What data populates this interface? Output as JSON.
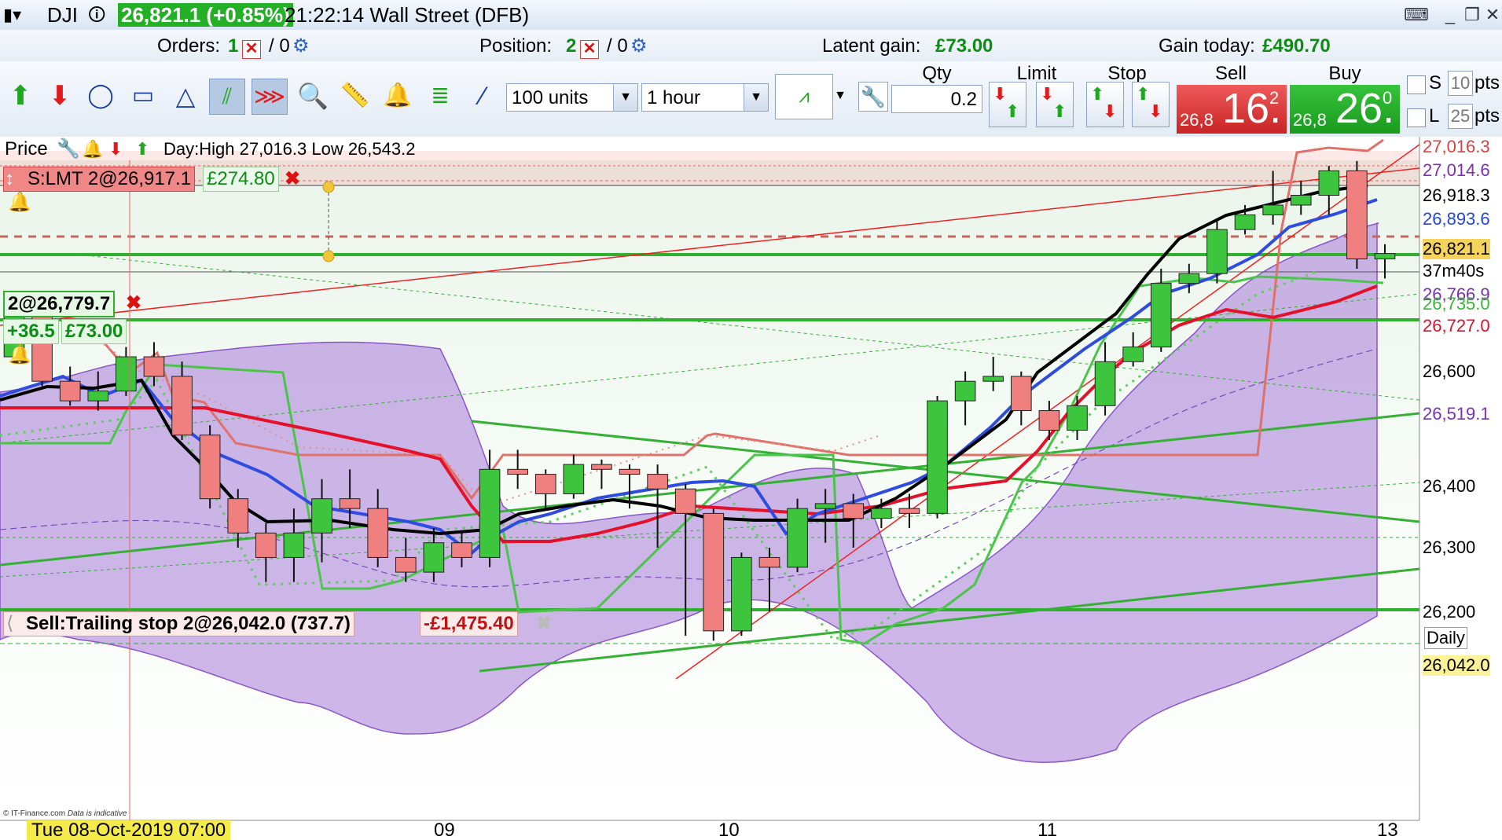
{
  "title_bar": {
    "symbol": "DJI",
    "price_change": "26,821.1 (+0.85%)",
    "clock_market": "21:22:14 Wall Street (DFB)"
  },
  "info_bar": {
    "orders_label": "Orders:",
    "orders_count": "1",
    "orders_zero": "/ 0",
    "position_label": "Position:",
    "position_count": "2",
    "position_zero": "/ 0",
    "latent_gain_label": "Latent gain:",
    "latent_gain_value": "£73.00",
    "gain_today_label": "Gain today:",
    "gain_today_value": "£490.70"
  },
  "toolbar": {
    "units_select": "100 units",
    "interval_select": "1 hour",
    "qty_header": "Qty",
    "qty_value": "0.2",
    "limit_header": "Limit",
    "stop_header": "Stop",
    "sell_header": "Sell",
    "buy_header": "Buy",
    "sell_prefix": "26,8",
    "sell_big": "16.",
    "sell_sup": "2",
    "buy_prefix": "26,8",
    "buy_big": "26.",
    "buy_sup": "0",
    "s_label": "S",
    "s_value": "10",
    "s_unit": "pts",
    "l_label": "L",
    "l_value": "25",
    "l_unit": "pts"
  },
  "chart_header": {
    "price_label": "Price",
    "day_range": "Day:High 27,016.3 Low 26,543.2"
  },
  "orders": {
    "limit_order": "S:LMT 2@26,917.1",
    "limit_gain": "£274.80",
    "position": "2@26,779.7",
    "position_pts": "+36.5",
    "position_gain": "£73.00",
    "trailing_stop": "Sell:Trailing stop 2@26,042.0 (737.7)",
    "trailing_loss": "-£1,475.40"
  },
  "price_axis": {
    "labels": [
      {
        "text": "27,016.3",
        "color": "#d94141"
      },
      {
        "text": "27,014.6",
        "color": "#7a2fb5"
      },
      {
        "text": "26,918.3",
        "color": "#000000"
      },
      {
        "text": "26,893.6",
        "color": "#2347d6"
      },
      {
        "text": "26,821.1",
        "color": "#000000"
      },
      {
        "text": "37m40s",
        "color": "#000000"
      },
      {
        "text": "26,766.9",
        "color": "#7a2fb5"
      },
      {
        "text": "26,735.0",
        "color": "#3ab53a"
      },
      {
        "text": "26,727.0",
        "color": "#d8132b"
      },
      {
        "text": "26,600",
        "color": "#000000"
      },
      {
        "text": "26,519.1",
        "color": "#7a2fb5"
      },
      {
        "text": "26,400",
        "color": "#000000"
      },
      {
        "text": "26,300",
        "color": "#000000"
      },
      {
        "text": "26,200",
        "color": "#000000"
      },
      {
        "text": "Daily",
        "color": "#000000"
      },
      {
        "text": "26,042.0",
        "color": "#000000"
      }
    ]
  },
  "time_axis": {
    "cursor_label": "Tue 08-Oct-2019 07:00",
    "labels": [
      "09",
      "10",
      "11",
      "13"
    ]
  },
  "footer": {
    "credit": "© IT-Finance.com",
    "note": "Data is indicative"
  },
  "chart_data": {
    "type": "candlestick",
    "ylim": [
      26000,
      27050
    ],
    "x_ticks": [
      "09",
      "10",
      "11",
      "13"
    ],
    "candles": [
      {
        "o": 26610,
        "c": 26700,
        "h": 26705,
        "l": 26600
      },
      {
        "o": 26700,
        "c": 26560,
        "h": 26705,
        "l": 26550
      },
      {
        "o": 26560,
        "c": 26520,
        "h": 26590,
        "l": 26510
      },
      {
        "o": 26520,
        "c": 26540,
        "h": 26580,
        "l": 26500
      },
      {
        "o": 26540,
        "c": 26610,
        "h": 26630,
        "l": 26530
      },
      {
        "o": 26610,
        "c": 26570,
        "h": 26640,
        "l": 26550
      },
      {
        "o": 26570,
        "c": 26450,
        "h": 26600,
        "l": 26440
      },
      {
        "o": 26450,
        "c": 26320,
        "h": 26470,
        "l": 26300
      },
      {
        "o": 26320,
        "c": 26250,
        "h": 26340,
        "l": 26220
      },
      {
        "o": 26250,
        "c": 26200,
        "h": 26270,
        "l": 26150
      },
      {
        "o": 26200,
        "c": 26250,
        "h": 26300,
        "l": 26150
      },
      {
        "o": 26250,
        "c": 26320,
        "h": 26360,
        "l": 26190
      },
      {
        "o": 26320,
        "c": 26300,
        "h": 26380,
        "l": 26260
      },
      {
        "o": 26300,
        "c": 26200,
        "h": 26340,
        "l": 26180
      },
      {
        "o": 26200,
        "c": 26170,
        "h": 26240,
        "l": 26150
      },
      {
        "o": 26170,
        "c": 26230,
        "h": 26260,
        "l": 26150
      },
      {
        "o": 26230,
        "c": 26200,
        "h": 26250,
        "l": 26180
      },
      {
        "o": 26200,
        "c": 26380,
        "h": 26420,
        "l": 26180
      },
      {
        "o": 26380,
        "c": 26370,
        "h": 26420,
        "l": 26340
      },
      {
        "o": 26370,
        "c": 26330,
        "h": 26380,
        "l": 26300
      },
      {
        "o": 26330,
        "c": 26390,
        "h": 26410,
        "l": 26320
      },
      {
        "o": 26390,
        "c": 26380,
        "h": 26400,
        "l": 26340
      },
      {
        "o": 26380,
        "c": 26370,
        "h": 26390,
        "l": 26300
      },
      {
        "o": 26370,
        "c": 26340,
        "h": 26390,
        "l": 26220
      },
      {
        "o": 26340,
        "c": 26290,
        "h": 26350,
        "l": 26040
      },
      {
        "o": 26290,
        "c": 26050,
        "h": 26300,
        "l": 26030
      },
      {
        "o": 26050,
        "c": 26200,
        "h": 26210,
        "l": 26040
      },
      {
        "o": 26200,
        "c": 26180,
        "h": 26220,
        "l": 26090
      },
      {
        "o": 26180,
        "c": 26300,
        "h": 26320,
        "l": 26170
      },
      {
        "o": 26300,
        "c": 26310,
        "h": 26340,
        "l": 26230
      },
      {
        "o": 26310,
        "c": 26280,
        "h": 26330,
        "l": 26220
      },
      {
        "o": 26280,
        "c": 26300,
        "h": 26320,
        "l": 26260
      },
      {
        "o": 26300,
        "c": 26290,
        "h": 26330,
        "l": 26260
      },
      {
        "o": 26290,
        "c": 26520,
        "h": 26530,
        "l": 26280
      },
      {
        "o": 26520,
        "c": 26560,
        "h": 26580,
        "l": 26470
      },
      {
        "o": 26560,
        "c": 26570,
        "h": 26610,
        "l": 26540
      },
      {
        "o": 26570,
        "c": 26500,
        "h": 26580,
        "l": 26470
      },
      {
        "o": 26500,
        "c": 26460,
        "h": 26520,
        "l": 26440
      },
      {
        "o": 26460,
        "c": 26510,
        "h": 26530,
        "l": 26440
      },
      {
        "o": 26510,
        "c": 26600,
        "h": 26640,
        "l": 26490
      },
      {
        "o": 26600,
        "c": 26630,
        "h": 26660,
        "l": 26590
      },
      {
        "o": 26630,
        "c": 26760,
        "h": 26790,
        "l": 26620
      },
      {
        "o": 26760,
        "c": 26780,
        "h": 26800,
        "l": 26740
      },
      {
        "o": 26780,
        "c": 26870,
        "h": 26890,
        "l": 26760
      },
      {
        "o": 26870,
        "c": 26900,
        "h": 26920,
        "l": 26860
      },
      {
        "o": 26900,
        "c": 26920,
        "h": 26990,
        "l": 26880
      },
      {
        "o": 26920,
        "c": 26940,
        "h": 26970,
        "l": 26900
      },
      {
        "o": 26940,
        "c": 26990,
        "h": 27000,
        "l": 26900
      },
      {
        "o": 26990,
        "c": 26810,
        "h": 27010,
        "l": 26790
      },
      {
        "o": 26810,
        "c": 26821,
        "h": 26840,
        "l": 26770
      }
    ]
  },
  "colors": {
    "bull": "#3dc63d",
    "bear": "#f08080",
    "ma_black": "#000000",
    "ma_blue": "#2f4ce0",
    "ma_red": "#e5112b",
    "band": "#9a6ad0",
    "trend_green": "#35b035"
  }
}
